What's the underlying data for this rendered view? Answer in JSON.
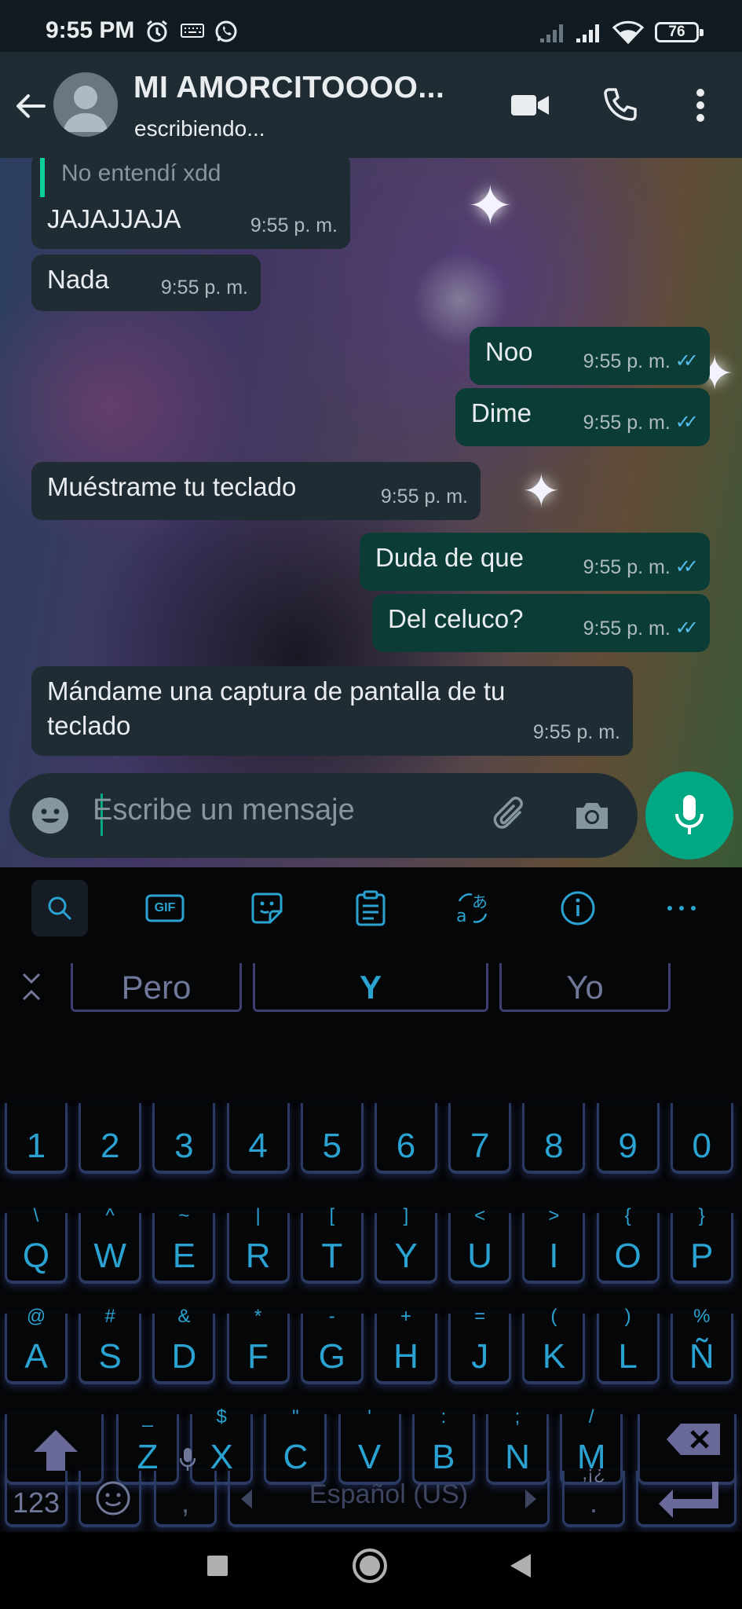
{
  "status_bar": {
    "time": "9:55 PM",
    "battery": "76"
  },
  "header": {
    "contact_name": "MI AMORCITOOOO...",
    "contact_status": "escribiendo..."
  },
  "messages": [
    {
      "direction": "in",
      "quote": "No entendí xdd",
      "text": "JAJAJJAJA",
      "time": "9:55 p. m."
    },
    {
      "direction": "in",
      "text": "Nada",
      "time": "9:55 p. m."
    },
    {
      "direction": "out",
      "text": "Noo",
      "time": "9:55 p. m.",
      "status": "read"
    },
    {
      "direction": "out",
      "text": "Dime",
      "time": "9:55 p. m.",
      "status": "read"
    },
    {
      "direction": "in",
      "text": "Muéstrame tu teclado",
      "time": "9:55 p. m."
    },
    {
      "direction": "out",
      "text": "Duda de que",
      "time": "9:55 p. m.",
      "status": "read"
    },
    {
      "direction": "out",
      "text": "Del celuco?",
      "time": "9:55 p. m.",
      "status": "read"
    },
    {
      "direction": "in",
      "text_line1": "Mándame una captura de pantalla de tu",
      "text_line2": "teclado",
      "time": "9:55 p. m."
    }
  ],
  "composer": {
    "placeholder": "Escribe un mensaje"
  },
  "keyboard": {
    "toolbar": [
      "search-icon",
      "gif-icon",
      "sticker-icon",
      "clipboard-icon",
      "translate-icon",
      "info-icon",
      "more-icon"
    ],
    "gif_label": "GIF",
    "suggestions": [
      "Pero",
      "Y",
      "Yo"
    ],
    "number_row": [
      "1",
      "2",
      "3",
      "4",
      "5",
      "6",
      "7",
      "8",
      "9",
      "0"
    ],
    "row1": [
      "Q",
      "W",
      "E",
      "R",
      "T",
      "Y",
      "U",
      "I",
      "O",
      "P"
    ],
    "row1_hints": [
      "\\",
      "^",
      "~",
      "|",
      "[",
      "]",
      "<",
      ">",
      "{",
      "}"
    ],
    "row2": [
      "A",
      "S",
      "D",
      "F",
      "G",
      "H",
      "J",
      "K",
      "L",
      "Ñ"
    ],
    "row2_hints": [
      "@",
      "#",
      "&",
      "*",
      "-",
      "+",
      "=",
      "(",
      ")",
      "%"
    ],
    "row3": [
      "Z",
      "X",
      "C",
      "V",
      "B",
      "N",
      "M"
    ],
    "row3_hints": [
      "_",
      "$",
      "\"",
      "'",
      ":",
      ";",
      "/"
    ],
    "symbols_label": "123",
    "comma": ",",
    "space_label": "Español (US)",
    "period": ".",
    "period_hint": ",¡¿"
  },
  "colors": {
    "accent": "#00a884",
    "outgoing_bubble": "#0b3d36",
    "incoming_bubble": "#1f2c34",
    "key_glow": "#2aa3d2"
  }
}
